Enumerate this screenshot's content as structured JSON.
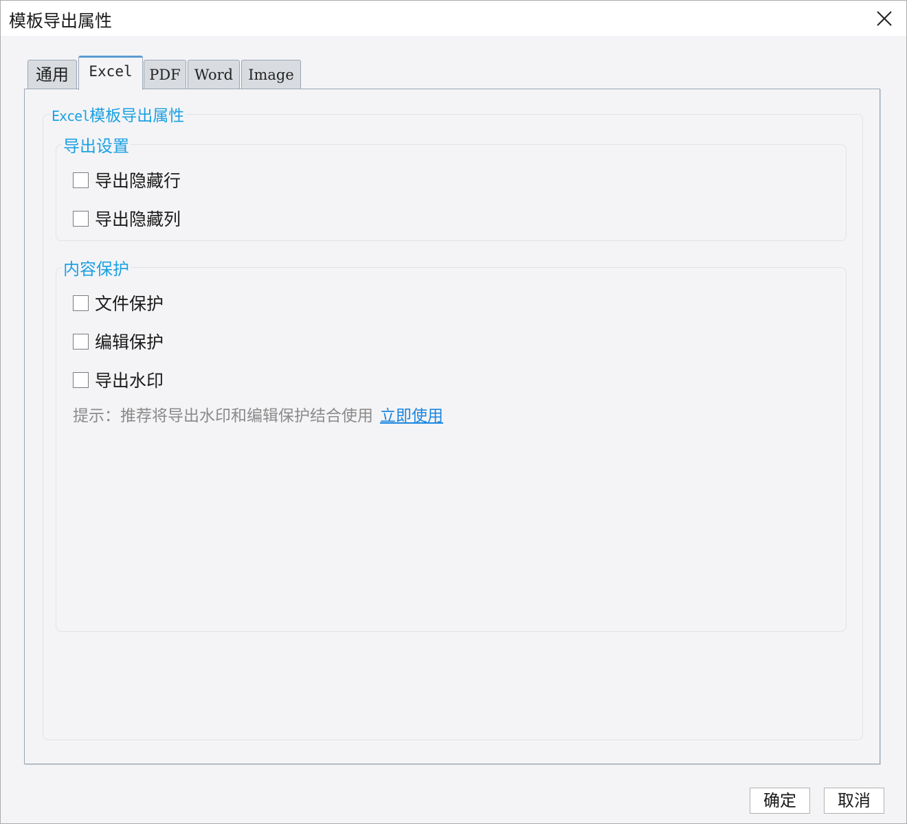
{
  "window": {
    "title": "模板导出属性",
    "close_icon": "close-icon"
  },
  "tabs": [
    {
      "label": "通用",
      "active": false
    },
    {
      "label": "Excel",
      "active": true
    },
    {
      "label": "PDF",
      "active": false
    },
    {
      "label": "Word",
      "active": false
    },
    {
      "label": "Image",
      "active": false
    }
  ],
  "panel": {
    "legend_prefix": "Excel",
    "legend_suffix": "模板导出属性",
    "export_settings": {
      "legend": "导出设置",
      "items": [
        {
          "label": "导出隐藏行",
          "checked": false
        },
        {
          "label": "导出隐藏列",
          "checked": false
        }
      ]
    },
    "content_protection": {
      "legend": "内容保护",
      "items": [
        {
          "label": "文件保护",
          "checked": false
        },
        {
          "label": "编辑保护",
          "checked": false
        },
        {
          "label": "导出水印",
          "checked": false
        }
      ],
      "hint": "提示：推荐将导出水印和编辑保护结合使用",
      "hint_link": "立即使用"
    }
  },
  "footer": {
    "ok_label": "确定",
    "cancel_label": "取消"
  },
  "colors": {
    "accent": "#1ba1e2",
    "link": "#1a86e0",
    "active_tab_top": "#5b9bd5"
  }
}
